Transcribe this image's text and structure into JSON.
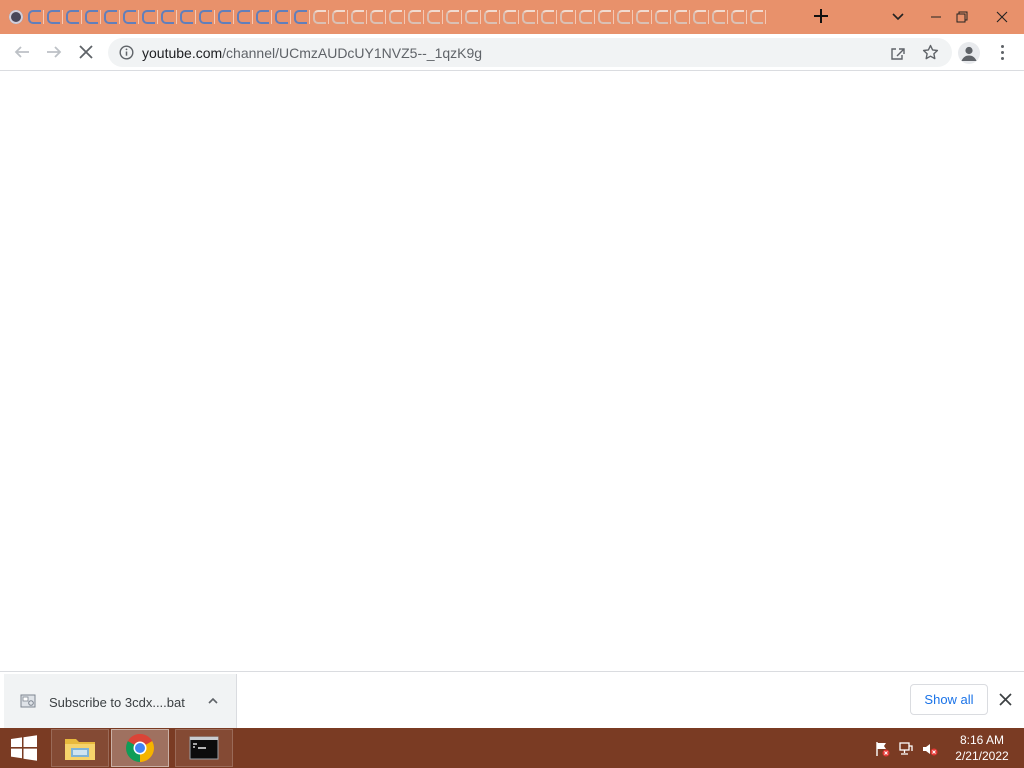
{
  "browser": {
    "url_host": "youtube.com",
    "url_path": "/channel/UCmzAUDcUY1NVZ5--_1qzK9g",
    "tab_count_icons": 40
  },
  "download_shelf": {
    "item_name": "Subscribe to 3cdx....bat",
    "show_all_label": "Show all"
  },
  "taskbar": {
    "apps": [
      "file-explorer",
      "google-chrome",
      "command-prompt"
    ],
    "time": "8:16 AM",
    "date": "2/21/2022"
  },
  "colors": {
    "tabstrip": "#e8916b",
    "taskbar": "#7a3b23",
    "accent": "#1a73e8"
  }
}
